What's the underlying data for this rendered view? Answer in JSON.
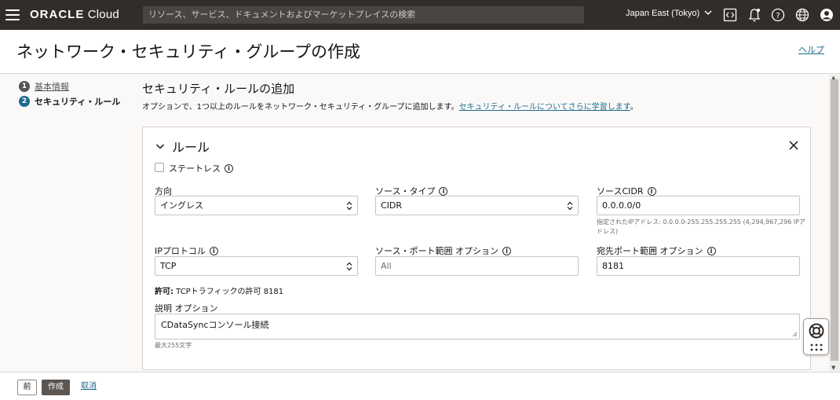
{
  "topbar": {
    "logo_bold": "ORACLE",
    "logo_light": " Cloud",
    "search_placeholder": "リソース、サービス、ドキュメントおよびマーケットプレイスの検索",
    "region": "Japan East (Tokyo)"
  },
  "page": {
    "title": "ネットワーク・セキュリティ・グループの作成",
    "help": "ヘルプ"
  },
  "steps": [
    {
      "num": "1",
      "label": "基本情報"
    },
    {
      "num": "2",
      "label": "セキュリティ・ルール"
    }
  ],
  "section": {
    "title": "セキュリティ・ルールの追加",
    "description": "オプションで、1つ以上のルールをネットワーク・セキュリティ・グループに追加します。",
    "learn_link": "セキュリティ・ルールについてさらに学習します",
    "period": "。"
  },
  "rule": {
    "title": "ルール",
    "stateless_label": "ステートレス",
    "stateless_checked": false,
    "direction_label": "方向",
    "direction_value": "イングレス",
    "source_type_label": "ソース・タイプ",
    "source_type_value": "CIDR",
    "source_cidr_label": "ソースCIDR",
    "source_cidr_value": "0.0.0.0/0",
    "source_cidr_hint": "指定されたIPアドレス: 0.0.0.0-255.255.255.255 (4,294,967,296 IPアドレス)",
    "protocol_label": "IPプロトコル",
    "protocol_value": "TCP",
    "source_port_label": "ソース・ポート範囲",
    "source_port_optional": "オプション",
    "source_port_placeholder": "All",
    "dest_port_label": "宛先ポート範囲",
    "dest_port_optional": "オプション",
    "dest_port_value": "8181",
    "permit_bold": "許可:",
    "permit_text": " TCPトラフィックの許可 8181",
    "desc_label": "説明",
    "desc_optional": "オプション",
    "desc_value": "CDataSyncコンソール接続",
    "desc_maxlen": "最大255文字"
  },
  "footer": {
    "prev": "前",
    "create": "作成",
    "cancel": "取消"
  },
  "colors": {
    "topbar_bg": "#312d2a",
    "link": "#1e6b8f",
    "primary_button": "#5b5652"
  }
}
